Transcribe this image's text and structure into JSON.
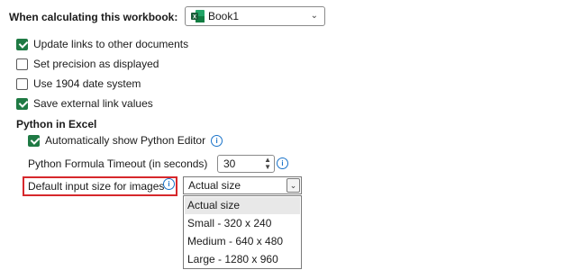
{
  "workbook": {
    "label": "When calculating this workbook:",
    "selected": "Book1",
    "icon": "excel-icon"
  },
  "options": [
    {
      "label": "Update links to other documents",
      "checked": true
    },
    {
      "label": "Set precision as displayed",
      "checked": false
    },
    {
      "label": "Use 1904 date system",
      "checked": false
    },
    {
      "label": "Save external link values",
      "checked": true
    }
  ],
  "python": {
    "heading": "Python in Excel",
    "auto_editor_label": "Automatically show Python Editor",
    "auto_editor_checked": true,
    "timeout_label": "Python Formula Timeout (in seconds)",
    "timeout_value": "30",
    "input_size_label": "Default input size for images",
    "input_size_selected": "Actual size",
    "input_size_options": [
      "Actual size",
      "Small - 320 x 240",
      "Medium - 640 x 480",
      "Large - 1280 x 960"
    ]
  },
  "icons": {
    "info": "i",
    "chevron": "⌄",
    "spin_up": "▲",
    "spin_down": "▼"
  },
  "colors": {
    "checkbox": "#1f7a44",
    "highlight": "#d6282c",
    "info": "#1a73c9"
  }
}
